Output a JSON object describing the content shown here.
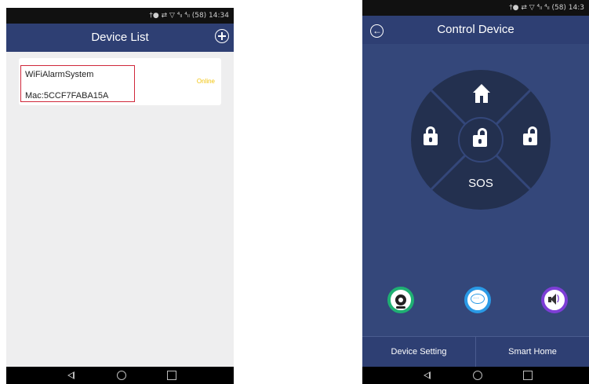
{
  "left_screen": {
    "status_bar": {
      "text": "†● ⇄ ▽ ⁴ₗₗ ⁴ₗₗ (58) 14:34"
    },
    "title": "Device List",
    "device": {
      "name": "WiFiAlarmSystem",
      "mac": "Mac:5CCF7FABA15A",
      "status": "Online"
    }
  },
  "right_screen": {
    "status_bar": {
      "text": "†● ⇄ ▽ ⁴ₗₗ ⁴ₗₗ (58) 14:3"
    },
    "title": "Control Device",
    "wheel": {
      "sos_label": "SOS"
    },
    "tabs": {
      "device_setting": "Device Setting",
      "smart_home": "Smart Home"
    }
  },
  "colors": {
    "title_bar": "#2e3f73",
    "control_bg": "#34477a",
    "wheel_bg": "#23304f",
    "online": "#f2c40e",
    "highlight_box": "#d0283b",
    "camera_ring": "#1fb073",
    "chat_ring": "#2a9ae6",
    "sound_ring": "#7d3ed6"
  },
  "icons": [
    "add-icon",
    "back-arrow-icon",
    "home-icon",
    "lock-icon",
    "camera-icon",
    "chat-icon",
    "speaker-icon",
    "nav-back-icon",
    "nav-home-icon",
    "nav-recent-icon"
  ]
}
